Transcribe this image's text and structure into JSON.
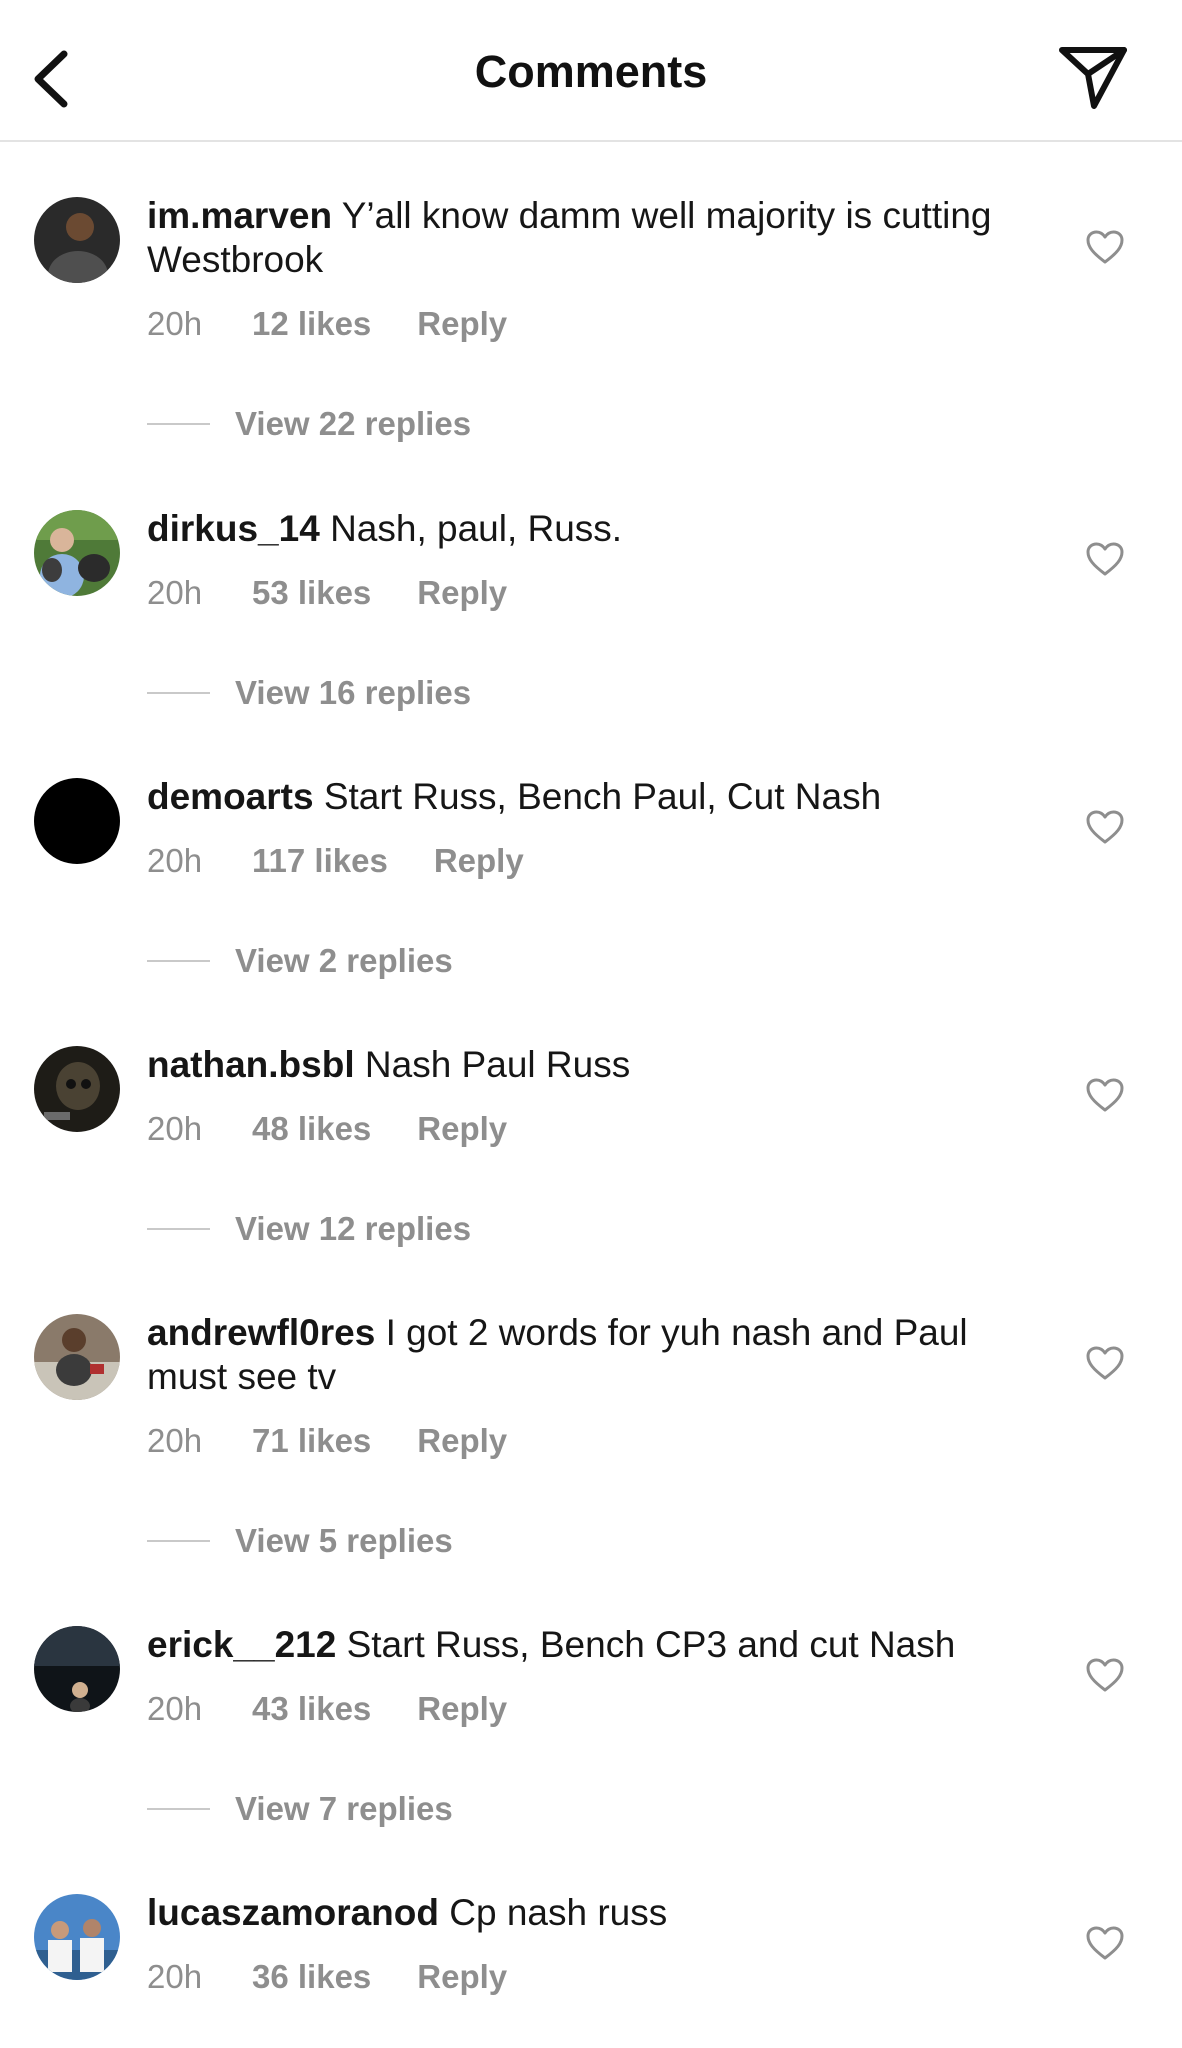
{
  "header": {
    "title": "Comments",
    "back_icon": "chevron-left-icon",
    "send_icon": "paper-plane-icon"
  },
  "comments": [
    {
      "username": "im.marven",
      "text": "Y’all know damm well majority is cutting Westbrook",
      "time": "20h",
      "likes": "12 likes",
      "reply": "Reply",
      "view_replies": "View 22 replies"
    },
    {
      "username": "dirkus_14",
      "text": "Nash, paul, Russ.",
      "time": "20h",
      "likes": "53 likes",
      "reply": "Reply",
      "view_replies": "View 16 replies"
    },
    {
      "username": "demoarts",
      "text": "Start Russ, Bench Paul, Cut Nash",
      "time": "20h",
      "likes": "117 likes",
      "reply": "Reply",
      "view_replies": "View 2 replies"
    },
    {
      "username": "nathan.bsbl",
      "text": "Nash Paul Russ",
      "time": "20h",
      "likes": "48 likes",
      "reply": "Reply",
      "view_replies": "View 12 replies"
    },
    {
      "username": "andrewfl0res",
      "text": "I got 2 words for yuh nash and Paul must see tv",
      "time": "20h",
      "likes": "71 likes",
      "reply": "Reply",
      "view_replies": "View 5 replies"
    },
    {
      "username": "erick__212",
      "text": "Start Russ, Bench CP3 and cut Nash",
      "time": "20h",
      "likes": "43 likes",
      "reply": "Reply",
      "view_replies": "View 7 replies"
    },
    {
      "username": "lucaszamoranod",
      "text": "Cp nash russ",
      "time": "20h",
      "likes": "36 likes",
      "reply": "Reply"
    }
  ],
  "colors": {
    "meta_text": "#8e8e8e",
    "text": "#161616",
    "divider": "#e3e3e3"
  }
}
